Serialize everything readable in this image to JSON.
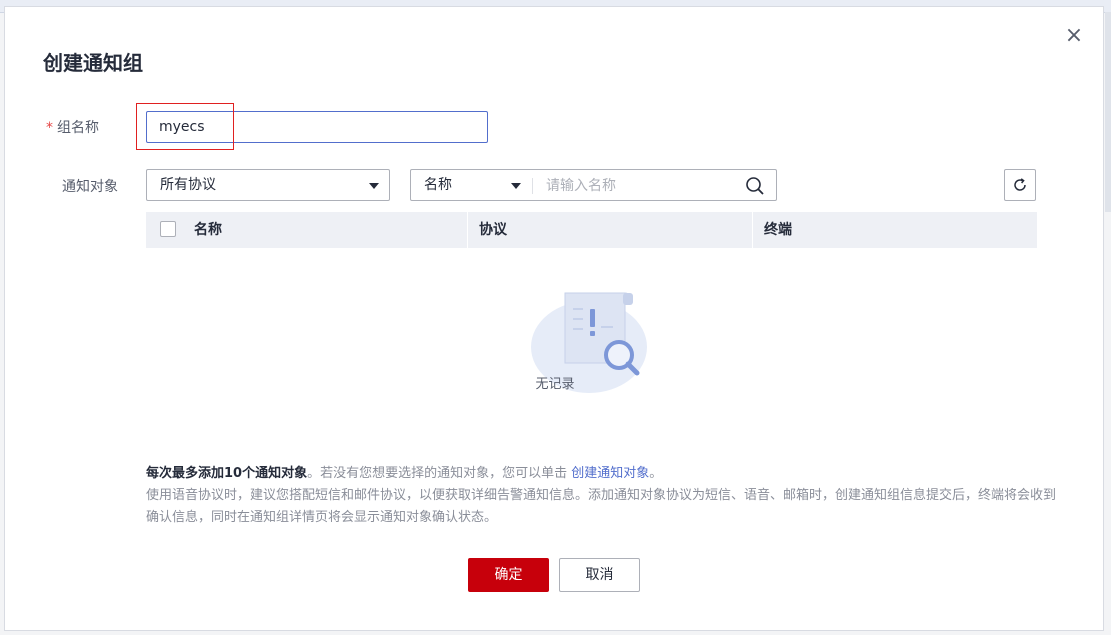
{
  "dialog": {
    "title": "创建通知组",
    "close_symbol": "×"
  },
  "form": {
    "group_name": {
      "required_mark": "*",
      "label": "组名称",
      "value": "myecs"
    },
    "notify_target": {
      "label": "通知对象",
      "protocol_select": "所有协议",
      "search_field_select": "名称",
      "search_placeholder": "请输入名称"
    }
  },
  "table": {
    "columns": [
      "名称",
      "协议",
      "终端"
    ],
    "empty_text": "无记录"
  },
  "notes": {
    "line1_bold": "每次最多添加10个通知对象",
    "line1_mid": "。若没有您想要选择的通知对象，您可以单击 ",
    "line1_link": "创建通知对象",
    "line1_end": "。",
    "line2": "使用语音协议时，建议您搭配短信和邮件协议，以便获取详细告警通知信息。添加通知对象协议为短信、语音、邮箱时，创建通知组信息提交后，终端将会收到确认信息，同时在通知组详情页将会显示通知对象确认状态。"
  },
  "buttons": {
    "confirm": "确定",
    "cancel": "取消"
  },
  "icons": {
    "close": "close-icon",
    "caret": "chevron-down-icon",
    "search": "search-icon",
    "refresh": "refresh-icon",
    "empty": "empty-document-search-icon"
  },
  "colors": {
    "primary_button": "#c7000b",
    "focus_border": "#526ecc",
    "link": "#526ecc",
    "required": "#e54545",
    "highlight_box": "#e02020"
  }
}
